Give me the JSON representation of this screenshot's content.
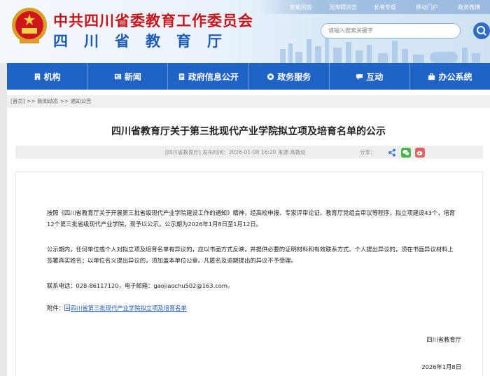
{
  "header": {
    "title": "中共四川省委教育工作委员会",
    "subtitle": "四川省教育厅",
    "toplinks": [
      "智能问答",
      "无障碍浏览",
      "长者专版",
      "移动门户",
      "政务微博"
    ],
    "search_placeholder": "请输入搜索关键字"
  },
  "nav": [
    {
      "label": "机构",
      "icon": "building-icon"
    },
    {
      "label": "新闻",
      "icon": "news-icon"
    },
    {
      "label": "政府信息公开",
      "icon": "document-icon"
    },
    {
      "label": "政务服务",
      "icon": "service-icon"
    },
    {
      "label": "互动",
      "icon": "chat-icon"
    },
    {
      "label": "办公系统",
      "icon": "office-icon"
    }
  ],
  "breadcrumb": {
    "home": "[首页]",
    "sep": ">>",
    "level1": "新闻动态",
    "level2": "通知公告"
  },
  "article": {
    "title": "四川省教育厅关于第三批现代产业学院拟立项及培育名单的公示",
    "meta_info": "[四川省教育厅]    发布时间：2026-01-08 16:20    来源:高教处",
    "share_label": "分享：",
    "p1": "按照《四川省教育厅关于开展第三批省级现代产业学院建设工作的通知》精神，经高校申报、专家评审论证、教育厅党组会审议等程序，拟立项建设43个，培育12个第三批省级现代产业学院，现予以公示，公示期为2026年1月8日至1月12日。",
    "p2": "公示期内，任何单位或个人对拟立项及培育名单有异议的，应以书面方式反映，并提供必要的证明材料和有效联系方式。个人提出异议的，须在书面异议材料上签署真实姓名；以单位名义提出异议的，须加盖本单位公章。凡匿名及逾期提出的异议不予受理。",
    "p3": "联系电话：028-86117120，电子邮箱：gaojiaochu502@163.com。",
    "attach_label": "附件：",
    "attach_link": "四川省第三批现代产业学院拟立项及培育名单",
    "signature": "四川省教育厅",
    "date": "2026年1月8日"
  },
  "colors": {
    "nav": "#1f63c6",
    "title_red": "#c8161d",
    "subtitle_blue": "#1d5db5"
  }
}
